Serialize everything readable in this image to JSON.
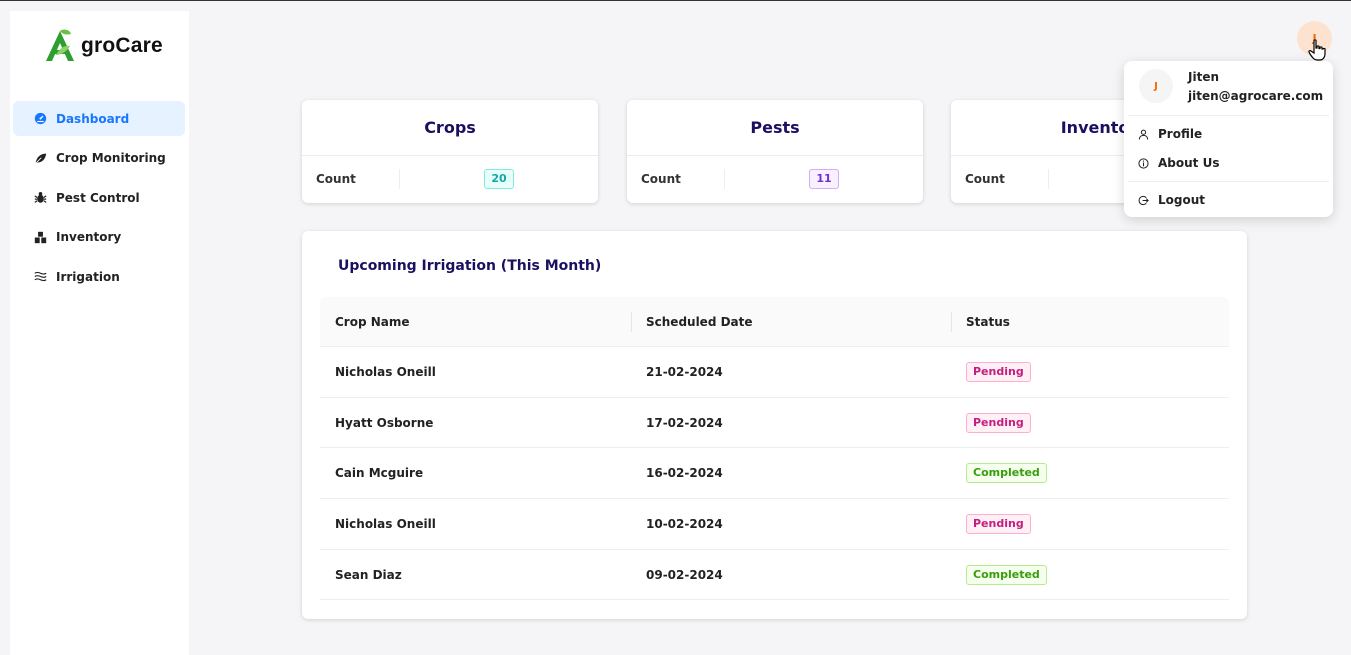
{
  "app": {
    "logo_text": "groCare",
    "logo_letter": "A"
  },
  "sidebar": {
    "items": [
      {
        "label": "Dashboard",
        "icon": "dashboard-icon",
        "active": true
      },
      {
        "label": "Crop Monitoring",
        "icon": "leaf-icon"
      },
      {
        "label": "Pest Control",
        "icon": "bug-icon"
      },
      {
        "label": "Inventory",
        "icon": "boxes-icon"
      },
      {
        "label": "Irrigation",
        "icon": "water-icon"
      }
    ]
  },
  "cards": [
    {
      "title": "Crops",
      "label": "Count",
      "value": "20",
      "color": "#13a8a8"
    },
    {
      "title": "Pests",
      "label": "Count",
      "value": "11",
      "color": "#722ed1"
    },
    {
      "title": "Inventor",
      "label": "Count",
      "value": ""
    }
  ],
  "irrigation": {
    "title": "Upcoming Irrigation (This Month)",
    "columns": [
      "Crop Name",
      "Scheduled Date",
      "Status"
    ],
    "rows": [
      {
        "crop": "Nicholas Oneill",
        "date": "21-02-2024",
        "status": "Pending"
      },
      {
        "crop": "Hyatt Osborne",
        "date": "17-02-2024",
        "status": "Pending"
      },
      {
        "crop": "Cain Mcguire",
        "date": "16-02-2024",
        "status": "Completed"
      },
      {
        "crop": "Nicholas Oneill",
        "date": "10-02-2024",
        "status": "Pending"
      },
      {
        "crop": "Sean Diaz",
        "date": "09-02-2024",
        "status": "Completed"
      }
    ]
  },
  "user": {
    "initial": "J",
    "name": "Jiten",
    "email": "jiten@agrocare.com",
    "menu": [
      {
        "label": "Profile",
        "icon": "user-icon"
      },
      {
        "label": "About Us",
        "icon": "info-icon"
      },
      {
        "label": "Logout",
        "icon": "logout-icon"
      }
    ]
  },
  "colors": {
    "accent": "#1677ff",
    "title": "#1a1060",
    "pending": "#c41d7f",
    "completed": "#389e0d",
    "avatar": "#f56a00"
  }
}
